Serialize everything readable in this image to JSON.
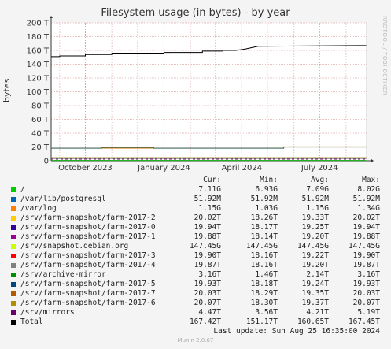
{
  "chart_data": {
    "type": "line",
    "title": "Filesystem usage (in bytes) - by year",
    "ylabel": "bytes",
    "ylim": [
      0,
      200
    ],
    "yticks": [
      "0",
      "20 T",
      "40 T",
      "60 T",
      "80 T",
      "100 T",
      "120 T",
      "140 T",
      "160 T",
      "180 T",
      "200 T"
    ],
    "xtick_labels": [
      "October 2023",
      "January 2024",
      "April 2024",
      "July 2024"
    ],
    "xlim": [
      "2023-08-22",
      "2024-08-25"
    ],
    "xticks": [
      "2023-10-01",
      "2024-01-01",
      "2024-04-01",
      "2024-07-01"
    ],
    "grid": true,
    "series": [
      {
        "name": "Total",
        "color": "#000000",
        "x": [
          "2023-08-22",
          "2023-09-01",
          "2023-09-01",
          "2023-10-01",
          "2023-10-01",
          "2023-11-01",
          "2023-11-01",
          "2024-01-01",
          "2024-01-01",
          "2024-02-15",
          "2024-02-15",
          "2024-03-10",
          "2024-03-10",
          "2024-03-25",
          "2024-04-05",
          "2024-04-20",
          "2024-08-15",
          "2024-08-25"
        ],
        "values": [
          151,
          151,
          152,
          152,
          154,
          154,
          156,
          156,
          157,
          157,
          159,
          159,
          160,
          160,
          162,
          166,
          167,
          167
        ]
      },
      {
        "name": "/srv/farm-snapshot/farm-2017-6",
        "color": "#cc7a00",
        "x": [
          "2023-08-22",
          "2024-05-20",
          "2024-05-20",
          "2024-08-25"
        ],
        "values": [
          18.3,
          18.3,
          20.07,
          20.07
        ]
      },
      {
        "name": "/srv/farm-snapshot/farm-2017-5",
        "color": "#336666",
        "x": [
          "2023-08-22",
          "2023-10-20",
          "2023-10-20",
          "2023-12-20",
          "2023-12-20",
          "2024-05-20",
          "2024-05-20",
          "2024-08-25"
        ],
        "values": [
          18.2,
          18.2,
          19.3,
          19.3,
          18.2,
          18.2,
          19.93,
          19.93
        ]
      },
      {
        "name": "/srv/archive-mirror",
        "color": "#888888",
        "x": [
          "2023-08-22",
          "2024-08-25"
        ],
        "values": [
          3.16,
          3.16
        ]
      },
      {
        "name": "/srv/mirrors",
        "color": "#888800",
        "x": [
          "2023-08-22",
          "2024-08-25"
        ],
        "values": [
          4.47,
          4.47
        ]
      },
      {
        "name": "/",
        "color": "#00aa00",
        "x": [
          "2023-08-22",
          "2024-08-25"
        ],
        "values": [
          0.5,
          0.5
        ]
      }
    ]
  },
  "legend": {
    "headers": {
      "cur": "Cur:",
      "min": "Min:",
      "avg": "Avg:",
      "max": "Max:"
    },
    "rows": [
      {
        "name": "/",
        "color": "#00cc00",
        "cur": "7.11G",
        "min": "6.93G",
        "avg": "7.09G",
        "max": "8.02G"
      },
      {
        "name": "/var/lib/postgresql",
        "color": "#0066b3",
        "cur": "51.92M",
        "min": "51.92M",
        "avg": "51.92M",
        "max": "51.92M"
      },
      {
        "name": "/var/log",
        "color": "#ff8000",
        "cur": "1.15G",
        "min": "1.03G",
        "avg": "1.15G",
        "max": "1.34G"
      },
      {
        "name": "/srv/farm-snapshot/farm-2017-2",
        "color": "#ffcc00",
        "cur": "20.02T",
        "min": "18.26T",
        "avg": "19.33T",
        "max": "20.02T"
      },
      {
        "name": "/srv/farm-snapshot/farm-2017-0",
        "color": "#330099",
        "cur": "19.94T",
        "min": "18.17T",
        "avg": "19.25T",
        "max": "19.94T"
      },
      {
        "name": "/srv/farm-snapshot/farm-2017-1",
        "color": "#990099",
        "cur": "19.88T",
        "min": "18.14T",
        "avg": "19.20T",
        "max": "19.88T"
      },
      {
        "name": "/srv/snapshot.debian.org",
        "color": "#ccff00",
        "cur": "147.45G",
        "min": "147.45G",
        "avg": "147.45G",
        "max": "147.45G"
      },
      {
        "name": "/srv/farm-snapshot/farm-2017-3",
        "color": "#ff0000",
        "cur": "19.90T",
        "min": "18.16T",
        "avg": "19.22T",
        "max": "19.90T"
      },
      {
        "name": "/srv/farm-snapshot/farm-2017-4",
        "color": "#808080",
        "cur": "19.87T",
        "min": "18.16T",
        "avg": "19.20T",
        "max": "19.87T"
      },
      {
        "name": "/srv/archive-mirror",
        "color": "#008f00",
        "cur": "3.16T",
        "min": "1.46T",
        "avg": "2.14T",
        "max": "3.16T"
      },
      {
        "name": "/srv/farm-snapshot/farm-2017-5",
        "color": "#00487d",
        "cur": "19.93T",
        "min": "18.18T",
        "avg": "19.24T",
        "max": "19.93T"
      },
      {
        "name": "/srv/farm-snapshot/farm-2017-7",
        "color": "#b35a00",
        "cur": "20.03T",
        "min": "18.29T",
        "avg": "19.35T",
        "max": "20.03T"
      },
      {
        "name": "/srv/farm-snapshot/farm-2017-6",
        "color": "#b38f00",
        "cur": "20.07T",
        "min": "18.30T",
        "avg": "19.37T",
        "max": "20.07T"
      },
      {
        "name": "/srv/mirrors",
        "color": "#6b006b",
        "cur": "4.47T",
        "min": "3.56T",
        "avg": "4.21T",
        "max": "5.19T"
      },
      {
        "name": "Total",
        "color": "#000000",
        "cur": "167.42T",
        "min": "151.17T",
        "avg": "160.65T",
        "max": "167.45T"
      }
    ]
  },
  "footer": {
    "last_update": "Last update: Sun Aug 25 16:35:00 2024",
    "munin": "Munin 2.0.67"
  },
  "watermark": "RRDTOOL / TOBI OETIKER"
}
